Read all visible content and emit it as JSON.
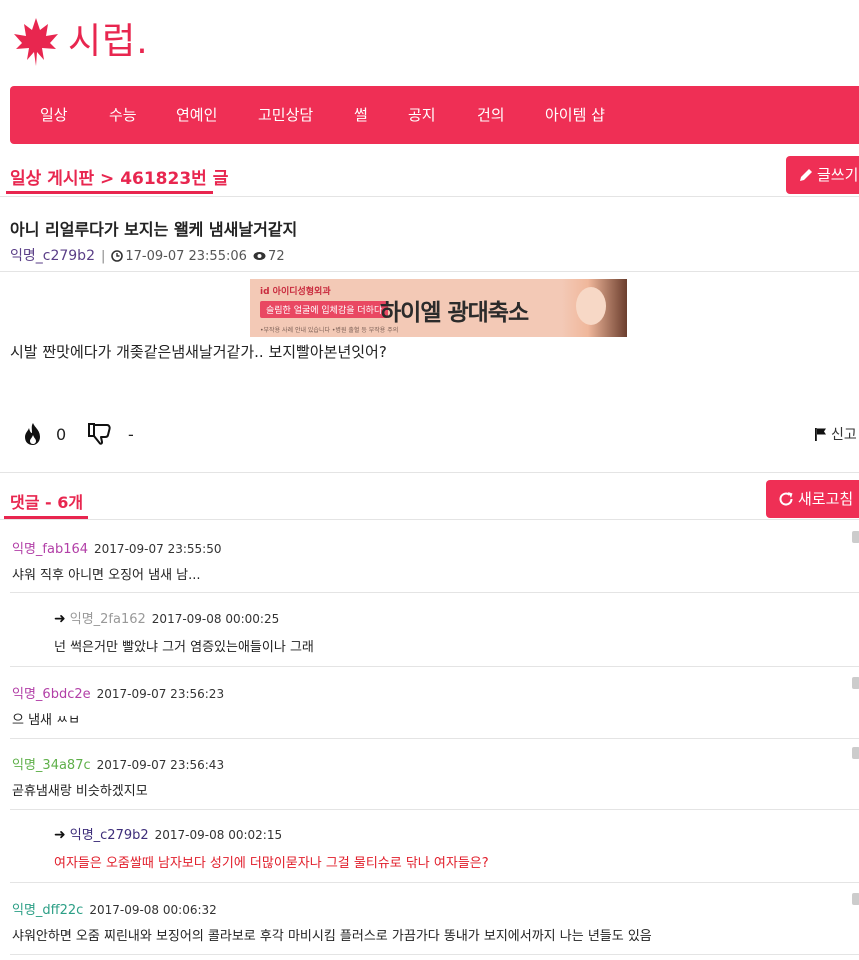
{
  "site": {
    "logo_text": "시럽.",
    "accent": "#ef2f55"
  },
  "nav": {
    "items": [
      "일상",
      "수능",
      "연예인",
      "고민상담",
      "썰",
      "공지",
      "건의",
      "아이템 샵"
    ]
  },
  "board": {
    "title": "일상 게시판 > 461823번 글",
    "write_label": "글쓰기"
  },
  "post": {
    "title": "아니 리얼루다가 보지는 왤케 냄새날거같지",
    "author": "익명_c279b2",
    "datetime": "17-09-07 23:55:06",
    "views": "72",
    "body": "시발 짠맛에다가 개좆같은냄새날거같가.. 보지빨아본년잇어?",
    "like_count": "0",
    "dislike_count": "-",
    "report_label": "신고"
  },
  "banner": {
    "brand": "id 아이디성형외과",
    "pill": "슬림한 얼굴에 입체감을 더하다",
    "headline": "하이엘 광대축소",
    "fine": "•부작용 사례 안내 있습니다   •병원 출혈 등 부작용 주의"
  },
  "comments_header": {
    "title": "댓글 - 6개",
    "refresh_label": "새로고침"
  },
  "comments": [
    {
      "nick": "익명_fab164",
      "time": "2017-09-07 23:55:50",
      "text": "샤워 직후 아니면 오징어 냄새 남..."
    },
    {
      "nick": "익명_2fa162",
      "time": "2017-09-08 00:00:25",
      "text": "넌 썩은거만 빨았냐 그거 염증있는애들이나 그래"
    },
    {
      "nick": "익명_6bdc2e",
      "time": "2017-09-07 23:56:23",
      "text": "으 냄새 ㅆㅂ"
    },
    {
      "nick": "익명_34a87c",
      "time": "2017-09-07 23:56:43",
      "text": "곧휴냄새랑 비슷하겠지모"
    },
    {
      "nick": "익명_c279b2",
      "time": "2017-09-08 00:02:15",
      "text": "여자들은 오줌쌀때 남자보다 성기에 더많이묻자나 그걸 물티슈로 닦나 여자들은?"
    },
    {
      "nick": "익명_dff22c",
      "time": "2017-09-08 00:06:32",
      "text": "샤워안하면 오줌 찌린내와 보징어의 콜라보로 후각 마비시킴 플러스로 가끔가다 똥내가 보지에서까지 나는 년들도 있음"
    }
  ]
}
